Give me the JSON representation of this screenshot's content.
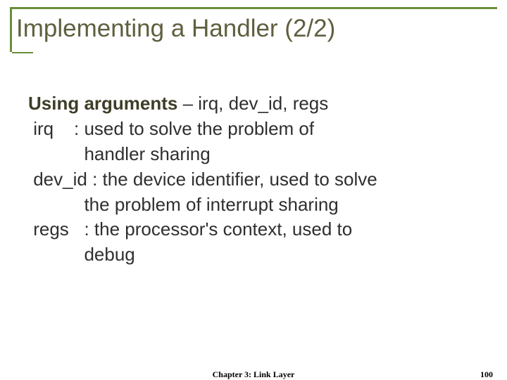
{
  "title": "Implementing a Handler (2/2)",
  "lead": {
    "label": "Using arguments",
    "rest": " – irq, dev_id, regs"
  },
  "lines": {
    "l1": " irq    : used to solve the problem of",
    "l2": "           handler sharing",
    "l3": " dev_id : the device identifier, used to solve",
    "l4": "           the problem of interrupt sharing",
    "l5": " regs   : the processor's context, used to",
    "l6": "           debug"
  },
  "footer": {
    "center": "Chapter 3: Link Layer",
    "page": "100"
  }
}
